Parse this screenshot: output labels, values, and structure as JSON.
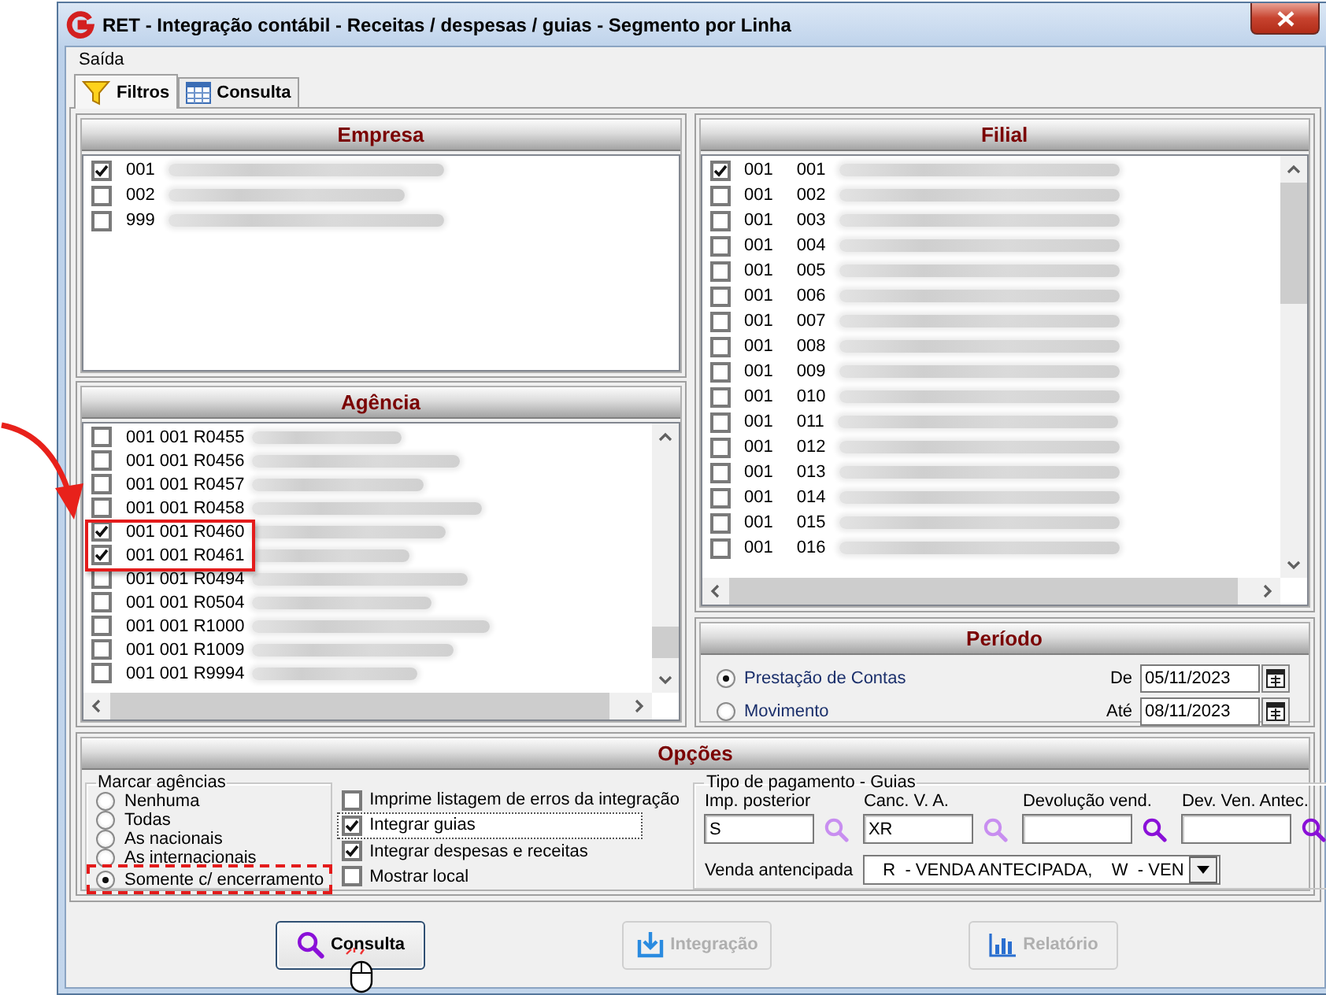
{
  "window": {
    "title": "RET - Integração contábil - Receitas / despesas / guias - Segmento por Linha"
  },
  "menu": [
    {
      "label": "Saída"
    }
  ],
  "tabs": [
    {
      "label": "Filtros",
      "kind": "filter",
      "selected": true
    },
    {
      "label": "Consulta",
      "kind": "table",
      "selected": false
    }
  ],
  "empresa": {
    "title": "Empresa",
    "items": [
      {
        "code": "001",
        "checked": true
      },
      {
        "code": "002",
        "checked": false
      },
      {
        "code": "999",
        "checked": false
      }
    ]
  },
  "agencia": {
    "title": "Agência",
    "items": [
      {
        "code": "001 001 R0455",
        "checked": false
      },
      {
        "code": "001 001 R0456",
        "checked": false
      },
      {
        "code": "001 001 R0457",
        "checked": false
      },
      {
        "code": "001 001 R0458",
        "checked": false
      },
      {
        "code": "001 001 R0460",
        "checked": true
      },
      {
        "code": "001 001 R0461",
        "checked": true
      },
      {
        "code": "001 001 R0494",
        "checked": false
      },
      {
        "code": "001 001 R0504",
        "checked": false
      },
      {
        "code": "001 001 R1000",
        "checked": false
      },
      {
        "code": "001 001 R1009",
        "checked": false
      },
      {
        "code": "001 001 R9994",
        "checked": false
      }
    ]
  },
  "filial": {
    "title": "Filial",
    "items": [
      {
        "company": "001",
        "branch": "001",
        "checked": true
      },
      {
        "company": "001",
        "branch": "002",
        "checked": false
      },
      {
        "company": "001",
        "branch": "003",
        "checked": false
      },
      {
        "company": "001",
        "branch": "004",
        "checked": false
      },
      {
        "company": "001",
        "branch": "005",
        "checked": false
      },
      {
        "company": "001",
        "branch": "006",
        "checked": false
      },
      {
        "company": "001",
        "branch": "007",
        "checked": false
      },
      {
        "company": "001",
        "branch": "008",
        "checked": false
      },
      {
        "company": "001",
        "branch": "009",
        "checked": false
      },
      {
        "company": "001",
        "branch": "010",
        "checked": false
      },
      {
        "company": "001",
        "branch": "011",
        "checked": false
      },
      {
        "company": "001",
        "branch": "012",
        "checked": false
      },
      {
        "company": "001",
        "branch": "013",
        "checked": false
      },
      {
        "company": "001",
        "branch": "014",
        "checked": false
      },
      {
        "company": "001",
        "branch": "015",
        "checked": false
      },
      {
        "company": "001",
        "branch": "016",
        "checked": false
      }
    ]
  },
  "periodo": {
    "title": "Período",
    "options": [
      {
        "label": "Prestação de Contas",
        "selected": true
      },
      {
        "label": "Movimento",
        "selected": false
      }
    ],
    "dates": [
      {
        "label": "De",
        "value": "05/11/2023"
      },
      {
        "label": "Até",
        "value": "08/11/2023"
      }
    ]
  },
  "opcoes": {
    "title": "Opções",
    "marcar": {
      "title": "Marcar agências",
      "options": [
        {
          "label": "Nenhuma",
          "selected": false
        },
        {
          "label": "Todas",
          "selected": false
        },
        {
          "label": "As nacionais",
          "selected": false
        },
        {
          "label": "As internacionais",
          "selected": false
        },
        {
          "label": "Somente c/ encerramento",
          "selected": true
        }
      ]
    },
    "checks": [
      {
        "label": "Imprime listagem de erros da integração",
        "checked": false,
        "focused": false
      },
      {
        "label": "Integrar guias",
        "checked": true,
        "focused": true
      },
      {
        "label": "Integrar despesas e receitas",
        "checked": true,
        "focused": false
      },
      {
        "label": "Mostrar local",
        "checked": false,
        "focused": false
      }
    ],
    "pagamento": {
      "title": "Tipo de pagamento - Guias",
      "fields": [
        {
          "label": "Imp. posterior",
          "value": "S",
          "lookup_disabled": true
        },
        {
          "label": "Canc. V. A.",
          "value": "XR",
          "lookup_disabled": true
        },
        {
          "label": "Devolução vend.",
          "lookup_disabled": false
        },
        {
          "label": "Dev. Ven. Antec.",
          "lookup_disabled": false
        }
      ],
      "combo": {
        "label": "Venda antencipada",
        "value": "R  - VENDA ANTECIPADA,    W  - VEN"
      }
    }
  },
  "buttons": [
    {
      "label": "Consulta",
      "kind": "search",
      "disabled": false
    },
    {
      "label": "Integração",
      "kind": "import",
      "disabled": true
    },
    {
      "label": "Relatório",
      "kind": "chart",
      "disabled": true
    }
  ]
}
